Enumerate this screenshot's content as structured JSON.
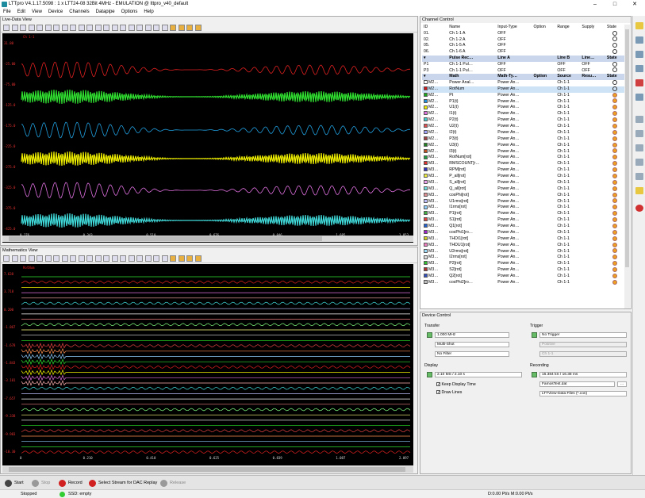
{
  "window": {
    "title": "LTTpro V4.1.17.5098 : 1 x LTT24-08 32Bit 4MHz - EMULATION @ lttpro_v40_default"
  },
  "menu": [
    "File",
    "Edit",
    "View",
    "Device",
    "Channels",
    "Datapipe",
    "Options",
    "Help"
  ],
  "live": {
    "title": "Live-Data View",
    "top_label": "Ch 1-1",
    "ylabels": [
      "31.80",
      "-25.00",
      "-75.00",
      "-125.0",
      "-175.0",
      "-225.0",
      "-275.0",
      "-325.0",
      "-375.0",
      "-425.0"
    ],
    "xlabels": [
      "0.176",
      "0.343",
      "0.510",
      "0.676",
      "0.846",
      "1.685",
      "1.853"
    ]
  },
  "math": {
    "title": "Mathematics View",
    "top_label": "RotNum",
    "ylabels": [
      "7.638",
      "3.718",
      "0.200",
      "-1.867",
      "-1.678",
      "-1.843",
      "-3.101",
      "-7.657",
      "-9.338",
      "-9.983",
      "-10.30"
    ],
    "xlabels": [
      "0",
      "0.210",
      "0.410",
      "0.625",
      "0.839",
      "1.087",
      "2.097"
    ],
    "xunit": "s"
  },
  "channel_control": {
    "title": "Channel Control",
    "input_header": [
      "ID",
      "Name",
      "Input-Type",
      "Option",
      "Range",
      "Supply",
      "State"
    ],
    "inputs": [
      {
        "id": "01.",
        "name": "Ch 1-1 A",
        "type": "OFF"
      },
      {
        "id": "02.",
        "name": "Ch 1-2 A",
        "type": "OFF"
      },
      {
        "id": "05.",
        "name": "Ch 1-5 A",
        "type": "OFF"
      },
      {
        "id": "06.",
        "name": "Ch 1-6 A",
        "type": "OFF"
      }
    ],
    "pulse_header": [
      "Pulse Rec…",
      "Line A",
      "Line B",
      "Line…",
      "State"
    ],
    "pulses": [
      {
        "id": "P1",
        "name": "Ch 1-1 Pul…",
        "a": "OFF",
        "b": "OFF",
        "c": "OFF"
      },
      {
        "id": "P3",
        "name": "Ch 1-1 Pul…",
        "a": "OFF",
        "b": "OFF",
        "c": "OFF"
      }
    ],
    "math_header": [
      "Math",
      "Math-Ty…",
      "Option",
      "Source",
      "Resu…",
      "State"
    ],
    "math_rows": [
      {
        "c": "#ffffff",
        "id": "M2…",
        "name": "Power Anal…",
        "type": "Power An…",
        "src": "Ch 1-1",
        "on": false
      },
      {
        "c": "#d01818",
        "id": "M2…",
        "name": "RotNum",
        "type": "Power An…",
        "src": "Ch 1-1",
        "on": false
      },
      {
        "c": "#18a818",
        "id": "M2…",
        "name": "Pt",
        "type": "Power An…",
        "src": "Ch 1-1",
        "on": true
      },
      {
        "c": "#2090e0",
        "id": "M2…",
        "name": "P1(t)",
        "type": "Power An…",
        "src": "Ch 1-1",
        "on": true
      },
      {
        "c": "#f0f000",
        "id": "M2…",
        "name": "U1(t)",
        "type": "Power An…",
        "src": "Ch 1-1",
        "on": true
      },
      {
        "c": "#e070e0",
        "id": "M2…",
        "name": "I1(t)",
        "type": "Power An…",
        "src": "Ch 1-1",
        "on": true
      },
      {
        "c": "#40d0d0",
        "id": "M2…",
        "name": "P2(t)",
        "type": "Power An…",
        "src": "Ch 1-1",
        "on": true
      },
      {
        "c": "#e05050",
        "id": "M2…",
        "name": "U2(t)",
        "type": "Power An…",
        "src": "Ch 1-1",
        "on": true
      },
      {
        "c": "#a0a0ff",
        "id": "M2…",
        "name": "I2(t)",
        "type": "Power An…",
        "src": "Ch 1-1",
        "on": true
      },
      {
        "c": "#a04040",
        "id": "M2…",
        "name": "P3(t)",
        "type": "Power An…",
        "src": "Ch 1-1",
        "on": true
      },
      {
        "c": "#208020",
        "id": "M2…",
        "name": "U3(t)",
        "type": "Power An…",
        "src": "Ch 1-1",
        "on": true
      },
      {
        "c": "#c05020",
        "id": "M2…",
        "name": "I3(t)",
        "type": "Power An…",
        "src": "Ch 1-1",
        "on": true
      },
      {
        "c": "#20a040",
        "id": "M3…",
        "name": "RotNum[rot]",
        "type": "Power An…",
        "src": "Ch 1-1",
        "on": true
      },
      {
        "c": "#e03030",
        "id": "M3…",
        "name": "RMSCOUNT[r…",
        "type": "Power An…",
        "src": "Ch 1-1",
        "on": true
      },
      {
        "c": "#3030c0",
        "id": "M3…",
        "name": "RPM[rot]",
        "type": "Power An…",
        "src": "Ch 1-1",
        "on": true
      },
      {
        "c": "#f0f040",
        "id": "M3…",
        "name": "P_all[rot]",
        "type": "Power An…",
        "src": "Ch 1-1",
        "on": true
      },
      {
        "c": "#f0a0f0",
        "id": "M3…",
        "name": "S_all[rot]",
        "type": "Power An…",
        "src": "Ch 1-1",
        "on": true
      },
      {
        "c": "#70e0e0",
        "id": "M3…",
        "name": "Q_all[rot]",
        "type": "Power An…",
        "src": "Ch 1-1",
        "on": true
      },
      {
        "c": "#e09090",
        "id": "M3…",
        "name": "cosPhi[rot]",
        "type": "Power An…",
        "src": "Ch 1-1",
        "on": true
      },
      {
        "c": "#c0c0ff",
        "id": "M3…",
        "name": "U1rms[rot]",
        "type": "Power An…",
        "src": "Ch 1-1",
        "on": true
      },
      {
        "c": "#90d0ff",
        "id": "M3…",
        "name": "I1rms[rot]",
        "type": "Power An…",
        "src": "Ch 1-1",
        "on": true
      },
      {
        "c": "#40b040",
        "id": "M3…",
        "name": "P1[rot]",
        "type": "Power An…",
        "src": "Ch 1-1",
        "on": true
      },
      {
        "c": "#e04040",
        "id": "M3…",
        "name": "S1[rot]",
        "type": "Power An…",
        "src": "Ch 1-1",
        "on": true
      },
      {
        "c": "#2060d0",
        "id": "M3…",
        "name": "Q1[rot]",
        "type": "Power An…",
        "src": "Ch 1-1",
        "on": true
      },
      {
        "c": "#a020d0",
        "id": "M3…",
        "name": "cosPhi1[ro…",
        "type": "Power An…",
        "src": "Ch 1-1",
        "on": true
      },
      {
        "c": "#d0d020",
        "id": "M3…",
        "name": "THDI1[rot]",
        "type": "Power An…",
        "src": "Ch 1-1",
        "on": true
      },
      {
        "c": "#f080c0",
        "id": "M3…",
        "name": "THDU1[rot]",
        "type": "Power An…",
        "src": "Ch 1-1",
        "on": true
      },
      {
        "c": "#a0e0ff",
        "id": "M3…",
        "name": "U2rms[rot]",
        "type": "Power An…",
        "src": "Ch 1-1",
        "on": true
      },
      {
        "c": "#e0e0e0",
        "id": "M3…",
        "name": "I2rms[rot]",
        "type": "Power An…",
        "src": "Ch 1-1",
        "on": true
      },
      {
        "c": "#30c030",
        "id": "M3…",
        "name": "P2[rot]",
        "type": "Power An…",
        "src": "Ch 1-1",
        "on": true
      },
      {
        "c": "#b03030",
        "id": "M3…",
        "name": "S2[rot]",
        "type": "Power An…",
        "src": "Ch 1-1",
        "on": true
      },
      {
        "c": "#3050c0",
        "id": "M3…",
        "name": "Q2[rot]",
        "type": "Power An…",
        "src": "Ch 1-1",
        "on": true
      },
      {
        "c": "#c0c0c0",
        "id": "M3…",
        "name": "cosPhi2[ro…",
        "type": "Power An…",
        "src": "Ch 1-1",
        "on": true
      }
    ]
  },
  "device_control": {
    "title": "Device Control",
    "transfer_label": "Transfer",
    "rate": "1.000 MHz",
    "mode": "Multi-Shot",
    "filter": "No Filter",
    "trigger_label": "Trigger",
    "trigger": "No Trigger",
    "trigger_edge": "Positive",
    "trigger_ch": "Ch 1-1",
    "display_label": "Display",
    "display_value": "2.10 MS / 2.10 s",
    "keep_display": "Keep Display Time",
    "draw_lines": "Draw Lines",
    "recording_label": "Recording",
    "recording_value": "16.384 kS / 16.38 ms",
    "file": "FamosTest.dat",
    "filetype": "LTTView-Data Files (*.con)"
  },
  "bottom": {
    "start": "Start",
    "stop": "Stop",
    "record": "Record",
    "dac": "Select Stream for DAC Replay",
    "extra": "Release"
  },
  "status": {
    "state": "Stopped",
    "ssd": "SSD: empty",
    "rate": "D:0.00 Pt/s M:0.00 Pt/s"
  }
}
